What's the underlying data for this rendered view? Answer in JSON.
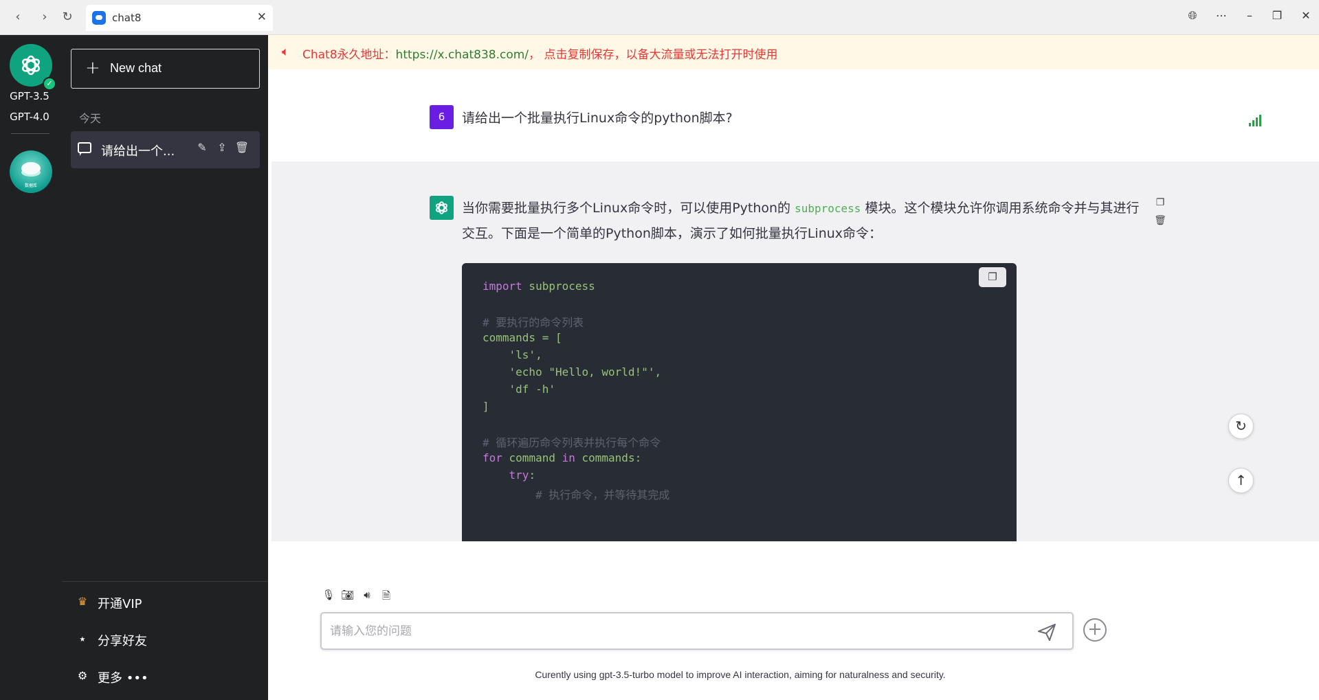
{
  "browser": {
    "tab_title": "chat8"
  },
  "rail": {
    "models": [
      "GPT-3.5",
      "GPT-4.0"
    ],
    "db_badge": "数据库"
  },
  "sidebar": {
    "new_chat_label": "New chat",
    "group_label": "今天",
    "conversations": [
      {
        "title": "请给出一个..."
      }
    ],
    "footer": {
      "vip_label": "开通VIP",
      "share_label": "分享好友",
      "more_label": "更多"
    }
  },
  "notice": {
    "prefix": "Chat8永久地址：",
    "link": "https://x.chat838.com/",
    "suffix": "， 点击复制保存，以备大流量或无法打开时使用"
  },
  "messages": {
    "user": {
      "avatar_label": "6",
      "text": "请给出一个批量执行Linux命令的python脚本?"
    },
    "assistant": {
      "text_before": "当你需要批量执行多个Linux命令时，可以使用Python的",
      "inline_code": "subprocess",
      "text_after": "模块。这个模块允许你调用系统命令并与其进行交互。下面是一个简单的Python脚本，演示了如何批量执行Linux命令：",
      "code": {
        "line1_kw": "import",
        "line1_rest": " subprocess",
        "comment1": "# 要执行的命令列表",
        "line3": "commands = [",
        "line4": "    'ls',",
        "line5": "    'echo \"Hello, world!\"',",
        "line6": "    'df -h'",
        "line7": "]",
        "comment2": "# 循环遍历命令列表并执行每个命令",
        "line9_kw1": "for",
        "line9_mid": " command ",
        "line9_kw2": "in",
        "line9_rest": " commands:",
        "line10_kw": "    try",
        "line10_rest": ":",
        "comment3": "        # 执行命令，并等待其完成"
      }
    }
  },
  "input": {
    "placeholder": "请输入您的问题"
  },
  "footer_note": "Curently using gpt-3.5-turbo model to improve AI interaction, aiming for naturalness and security.",
  "colors": {
    "sidebar_bg": "#202123",
    "accent_green": "#10a37f",
    "user_avatar": "#6a1ee3",
    "notice_text": "#e53935",
    "notice_link": "#2e7d32"
  }
}
